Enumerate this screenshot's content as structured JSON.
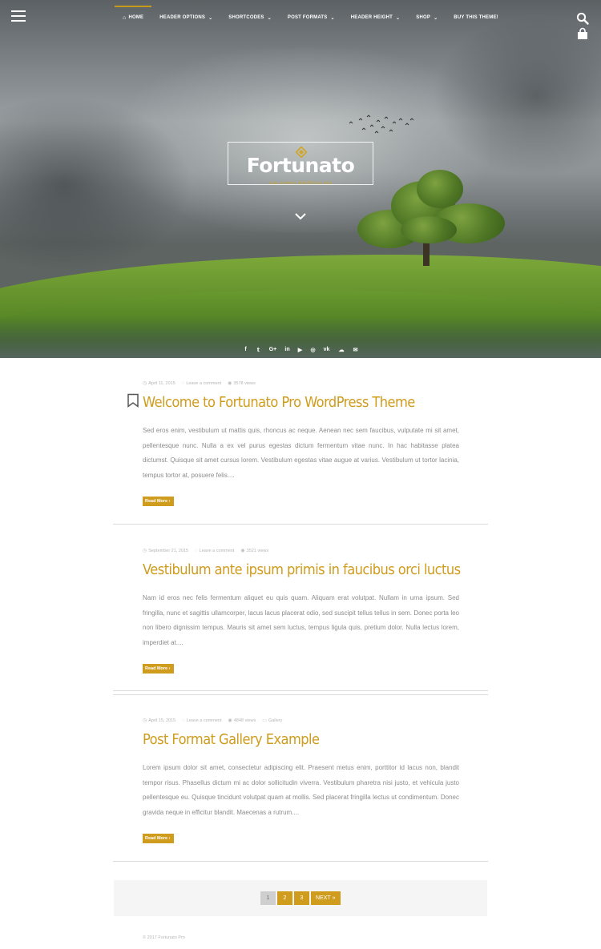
{
  "nav": {
    "items": [
      {
        "label": "HOME",
        "icon": "home-icon",
        "has_dropdown": false,
        "active": true
      },
      {
        "label": "HEADER OPTIONS",
        "has_dropdown": true
      },
      {
        "label": "SHORTCODES",
        "has_dropdown": true
      },
      {
        "label": "POST FORMATS",
        "has_dropdown": true
      },
      {
        "label": "HEADER HEIGHT",
        "has_dropdown": true
      },
      {
        "label": "SHOP",
        "has_dropdown": true
      },
      {
        "label": "BUY THIS THEME!",
        "has_dropdown": false
      }
    ]
  },
  "hero": {
    "site_title": "Fortunato",
    "tagline": "Just another WordPress site"
  },
  "social": [
    "facebook-icon",
    "twitter-icon",
    "google-plus-icon",
    "linkedin-icon",
    "youtube-icon",
    "instagram-icon",
    "vk-icon",
    "soundcloud-icon",
    "envelope-icon"
  ],
  "posts": [
    {
      "date": "April 11, 2015",
      "comments": "Leave a comment",
      "views": "3578 views",
      "category": "",
      "title": "Welcome to Fortunato Pro WordPress Theme",
      "excerpt": "Sed eros enim, vestibulum ut mattis quis, rhoncus ac neque. Aenean nec sem faucibus, vulputate mi sit amet, pellentesque nunc. Nulla a ex vel purus egestas dictum fermentum vitae nunc. In hac habitasse platea dictumst. Quisque sit amet cursus lorem. Vestibulum egestas vitae augue at varius. Vestibulum ut tortor lacinia, tempus tortor at, posuere felis....",
      "read_more": "Read More",
      "sticky": true
    },
    {
      "date": "September 21, 2015",
      "comments": "Leave a comment",
      "views": "3521 views",
      "category": "",
      "title": "Vestibulum ante ipsum primis in faucibus orci luctus",
      "excerpt": "Nam id eros nec felis fermentum aliquet eu quis quam. Aliquam erat volutpat. Nullam in urna ipsum. Sed fringilla, nunc et sagittis ullamcorper, lacus lacus placerat odio, sed suscipit tellus tellus in sem. Donec porta leo non libero dignissim tempus. Mauris sit amet sem luctus, tempus ligula quis, pretium dolor. Nulla lectus lorem, imperdiet at....",
      "read_more": "Read More",
      "sticky": false
    },
    {
      "date": "April 15, 2015",
      "comments": "Leave a comment",
      "views": "4848 views",
      "category": "Gallery",
      "title": "Post Format Gallery Example",
      "excerpt": "Lorem ipsum dolor sit amet, consectetur adipiscing elit. Praesent metus enim, porttitor id lacus non, blandit tempor risus. Phasellus dictum mi ac dolor sollicitudin viverra. Vestibulum pharetra nisi justo, et vehicula justo pellentesque eu. Quisque tincidunt volutpat quam at mollis. Sed placerat fringilla lectus ut condimentum. Donec gravida neque in efficitur blandit. Maecenas a rutrum....",
      "read_more": "Read More",
      "sticky": false
    }
  ],
  "pagination": {
    "pages": [
      "1",
      "2",
      "3"
    ],
    "current": "1",
    "next_label": "NEXT"
  },
  "footer": {
    "copyright": "© 2017 Fortunato Pro"
  },
  "colors": {
    "accent": "#cf9c1d",
    "text_muted": "#8c8c8c",
    "meta": "#b5b5b5"
  }
}
